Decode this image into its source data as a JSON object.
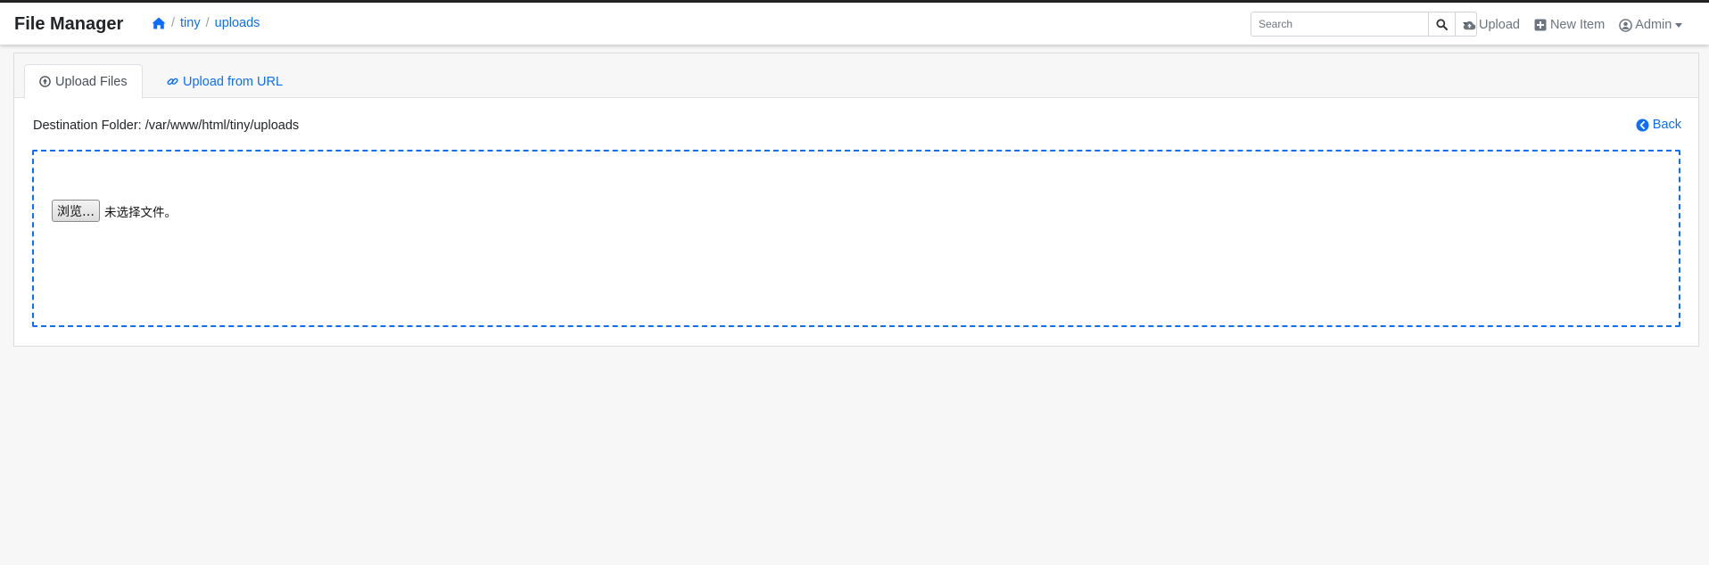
{
  "app": {
    "title": "File Manager"
  },
  "breadcrumb": {
    "home_icon": "home-icon",
    "items": [
      "tiny",
      "uploads"
    ],
    "separator": "/"
  },
  "search": {
    "placeholder": "Search"
  },
  "nav": {
    "upload": "Upload",
    "new_item": "New Item",
    "admin": "Admin"
  },
  "tabs": [
    {
      "label": "Upload Files",
      "icon": "upload-circle-icon",
      "active": true
    },
    {
      "label": "Upload from URL",
      "icon": "link-icon",
      "active": false
    }
  ],
  "destination": {
    "label": "Destination Folder:",
    "path": "/var/www/html/tiny/uploads"
  },
  "back": {
    "label": "Back",
    "icon": "chevron-circle-left-icon"
  },
  "file_input": {
    "button": "浏览…",
    "status": "未选择文件。"
  },
  "colors": {
    "accent": "#0d6efd",
    "dropzone_border": "#0d6efd",
    "page_bg": "#f7f7f7"
  }
}
